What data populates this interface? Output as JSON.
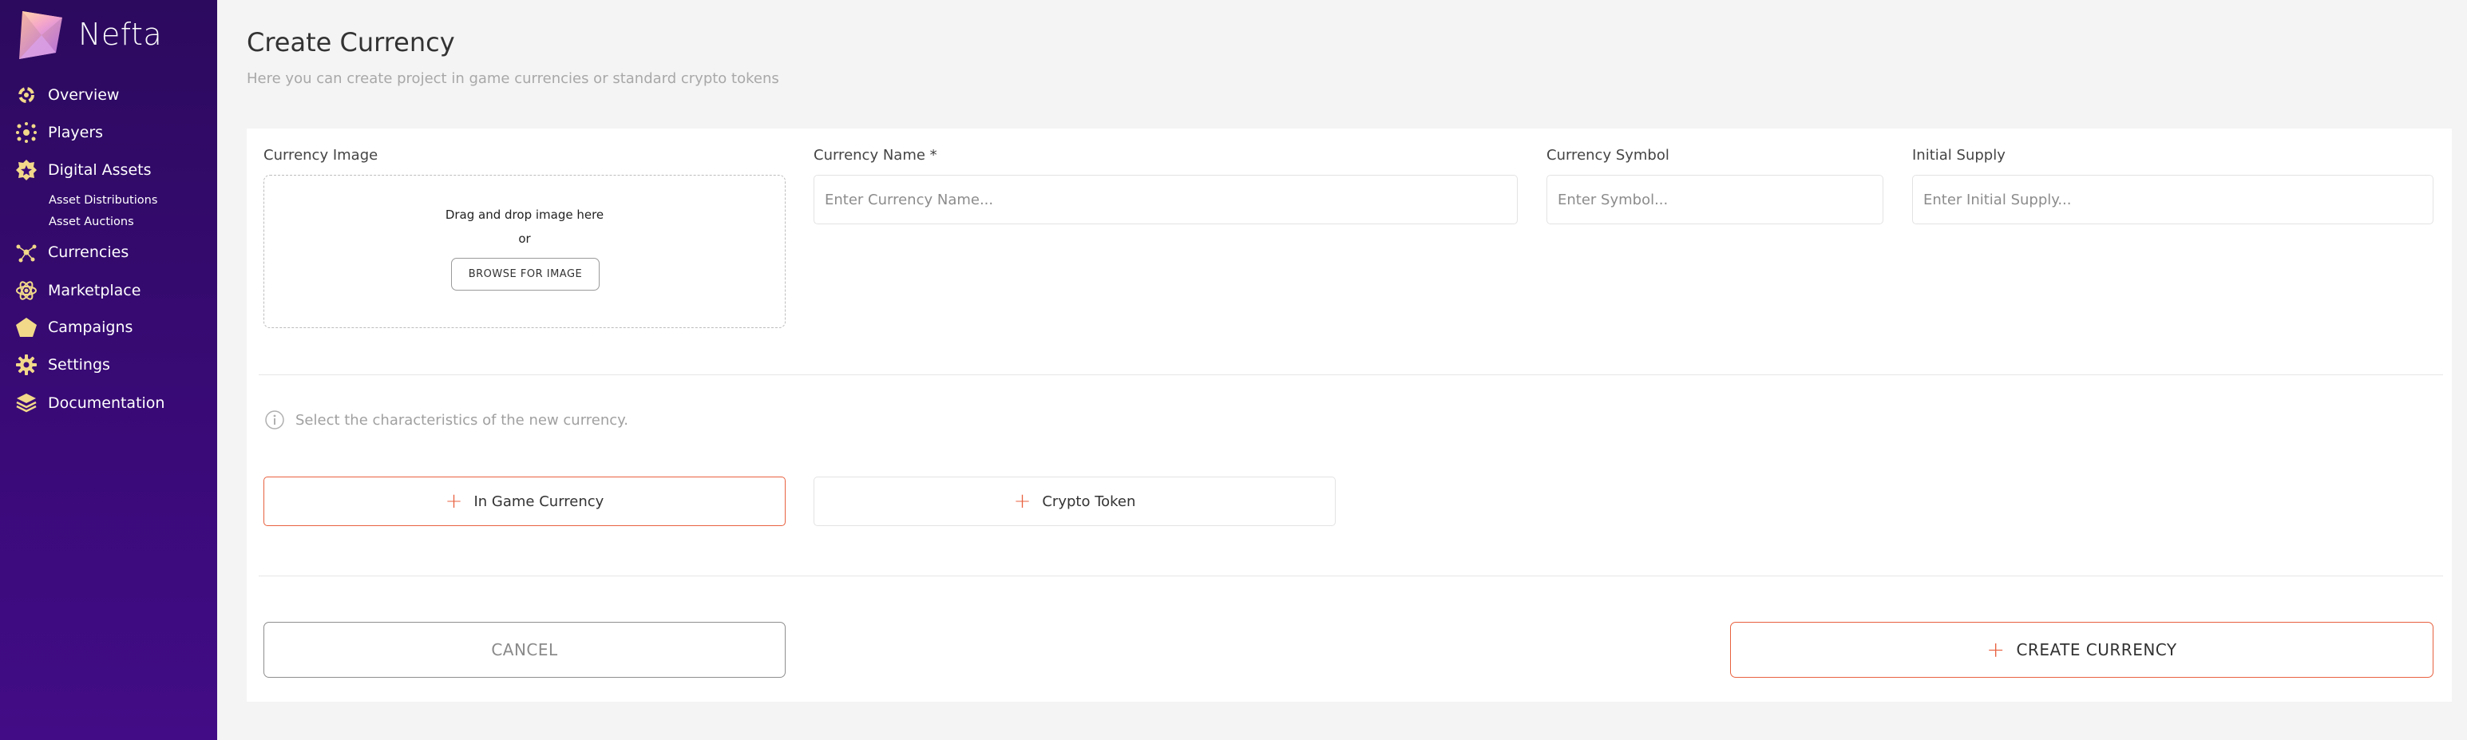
{
  "app": {
    "name": "Nefta"
  },
  "sidebar": {
    "items": [
      {
        "label": "Overview",
        "icon": "overview-icon"
      },
      {
        "label": "Players",
        "icon": "players-icon"
      },
      {
        "label": "Digital Assets",
        "icon": "digital-assets-icon"
      },
      {
        "label": "Currencies",
        "icon": "currencies-icon"
      },
      {
        "label": "Marketplace",
        "icon": "marketplace-icon"
      },
      {
        "label": "Campaigns",
        "icon": "campaigns-icon"
      },
      {
        "label": "Settings",
        "icon": "gear-icon"
      },
      {
        "label": "Documentation",
        "icon": "documentation-icon"
      }
    ],
    "sub_items": [
      {
        "label": "Asset Distributions"
      },
      {
        "label": "Asset Auctions"
      }
    ]
  },
  "header": {
    "title": "Create Currency",
    "subtitle": "Here you can create project in game currencies or standard crypto tokens"
  },
  "form": {
    "image": {
      "label": "Currency Image",
      "drop_text": "Drag and drop image here",
      "or_text": "or",
      "browse_label": "BROWSE FOR IMAGE"
    },
    "name": {
      "label": "Currency Name *",
      "placeholder": "Enter Currency Name...",
      "value": ""
    },
    "symbol": {
      "label": "Currency Symbol",
      "placeholder": "Enter Symbol...",
      "value": ""
    },
    "supply": {
      "label": "Initial Supply",
      "placeholder": "Enter Initial Supply...",
      "value": ""
    },
    "info_text": "Select the characteristics of the new currency.",
    "types": [
      {
        "label": "In Game Currency",
        "selected": true
      },
      {
        "label": "Crypto Token",
        "selected": false
      }
    ],
    "cancel_label": "CANCEL",
    "create_label": "CREATE CURRENCY"
  },
  "colors": {
    "sidebar_top": "#2c0a5e",
    "sidebar_bottom": "#420c86",
    "accent": "#e8613f",
    "icon_gold": "#f2d98a",
    "background": "#f4f4f4"
  }
}
